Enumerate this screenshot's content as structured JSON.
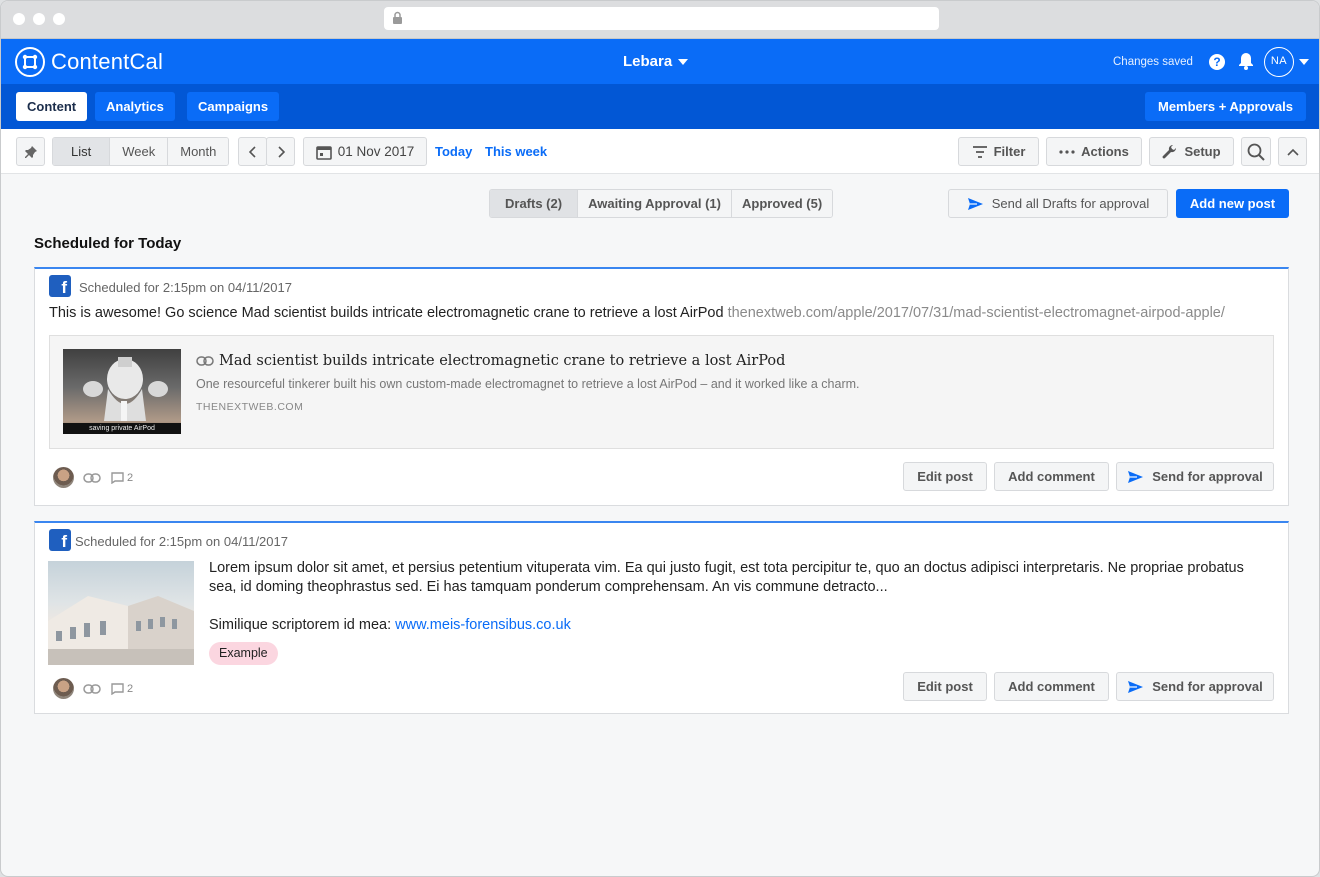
{
  "app": {
    "name": "ContentCal",
    "org": "Lebara",
    "status": "Changes saved",
    "help": "?",
    "user_initials": "NA"
  },
  "nav": {
    "tabs": [
      "Content",
      "Analytics",
      "Campaigns"
    ],
    "members": "Members + Approvals"
  },
  "toolbar": {
    "views": [
      "List",
      "Week",
      "Month"
    ],
    "date": "01 Nov 2017",
    "today": "Today",
    "this_week": "This week",
    "filter": "Filter",
    "actions": "Actions",
    "setup": "Setup"
  },
  "status_tabs": [
    "Drafts (2)",
    "Awaiting Approval (1)",
    "Approved (5)"
  ],
  "send_all": "Send all Drafts for approval",
  "add_new": "Add new post",
  "section_title": "Scheduled for Today",
  "posts": [
    {
      "scheduled": "Scheduled for 2:15pm on 04/11/2017",
      "text": "This is awesome! Go science Mad scientist builds intricate electromagnetic crane to retrieve a lost AirPod ",
      "url": "thenextweb.com/apple/2017/07/31/mad-scientist-electromagnet-airpod-apple/",
      "preview": {
        "title": "Mad scientist builds intricate electromagnetic crane to retrieve a lost AirPod",
        "description": "One resourceful tinkerer built his own custom-made electromagnet to retrieve a lost AirPod – and it worked like a charm.",
        "domain": "THENEXTWEB.COM",
        "image_caption": "saving private AirPod"
      },
      "comments": "2",
      "buttons": {
        "edit": "Edit post",
        "comment": "Add comment",
        "send": "Send for approval"
      }
    },
    {
      "scheduled": "Scheduled for 2:15pm on 04/11/2017",
      "text": "Lorem ipsum dolor sit amet, et persius petentium vituperata vim. Ea qui justo fugit, est tota percipitur te, quo an doctus adipisci interpretaris. Ne propriae probatus sea, id doming theophrastus sed. Ei has tamquam ponderum comprehensam. An vis commune detracto...",
      "text2_prefix": "Similique scriptorem id mea: ",
      "link": "www.meis-forensibus.co.uk",
      "tag": "Example",
      "comments": "2",
      "buttons": {
        "edit": "Edit post",
        "comment": "Add comment",
        "send": "Send for approval"
      }
    }
  ],
  "colors": {
    "brand": "#0a6cf7",
    "nav": "#0257d5",
    "tag": "#fbd6e0"
  }
}
